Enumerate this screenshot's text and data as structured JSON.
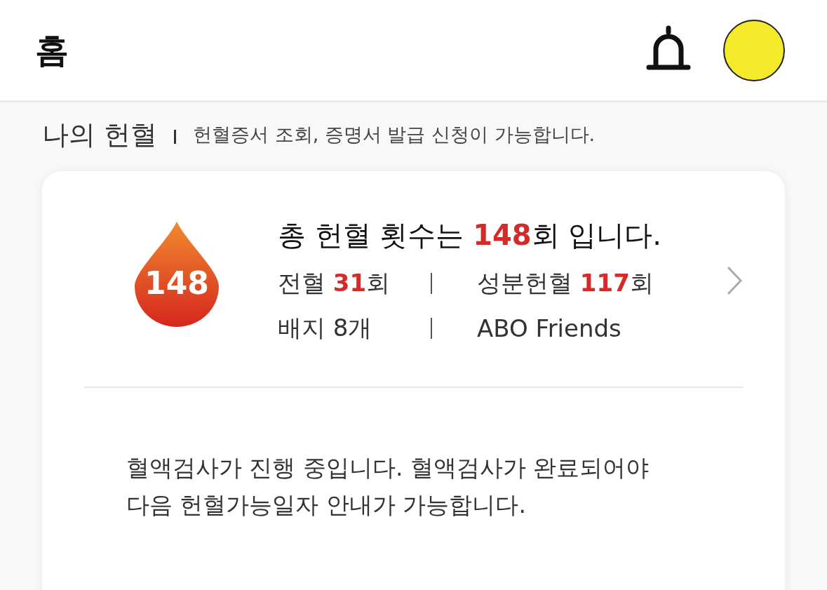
{
  "header": {
    "title": "홈"
  },
  "section": {
    "title": "나의 헌혈",
    "subtitle": "헌혈증서 조회, 증명서 발급 신청이 가능합니다."
  },
  "summary": {
    "drop_count": "148",
    "total": "총 헌혈 횟수는 **148**회 입니다.",
    "stats": [
      [
        "전혈 **31**회",
        "성분헌혈 **117**회"
      ],
      [
        "배지 8개",
        "ABO Friends"
      ]
    ]
  },
  "notice": [
    "혈액검사가 진행 중입니다. 혈액검사가 완료되어야",
    "다음 헌혈가능일자 안내가 가능합니다."
  ]
}
